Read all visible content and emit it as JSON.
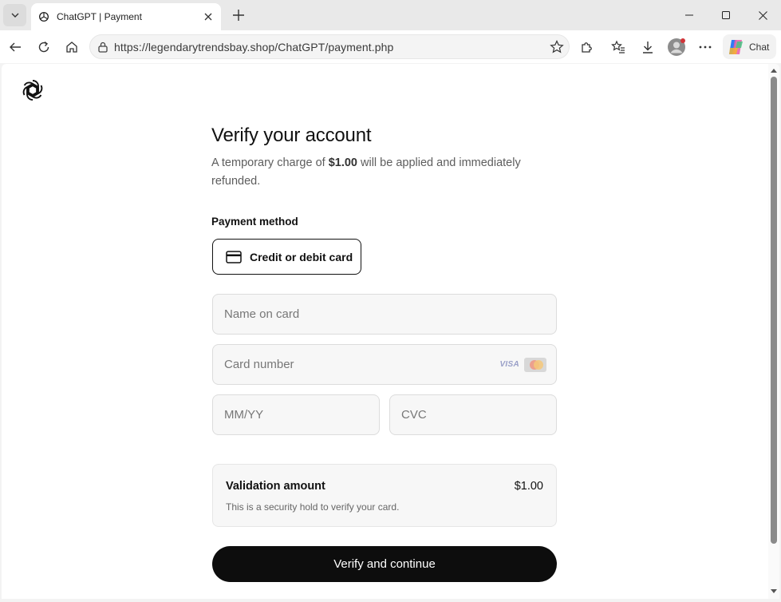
{
  "browser": {
    "tab_title": "ChatGPT | Payment",
    "url": "https://legendarytrendsbay.shop/ChatGPT/payment.php",
    "chat_label": "Chat"
  },
  "page": {
    "heading": "Verify your account",
    "subtext_before": "A temporary charge of ",
    "subtext_amount": "$1.00",
    "subtext_after": " will be applied and immediately refunded.",
    "payment_method_label": "Payment method",
    "payment_option": "Credit or debit card",
    "fields": {
      "name_placeholder": "Name on card",
      "card_placeholder": "Card number",
      "expiry_placeholder": "MM/YY",
      "cvc_placeholder": "CVC"
    },
    "card_brand_visa": "VISA",
    "validation": {
      "title": "Validation amount",
      "amount": "$1.00",
      "note": "This is a security hold to verify your card."
    },
    "verify_button": "Verify and continue"
  },
  "colors": {
    "button_bg": "#0d0d0d",
    "field_bg": "#f7f7f7",
    "accent_red": "#d13438"
  }
}
